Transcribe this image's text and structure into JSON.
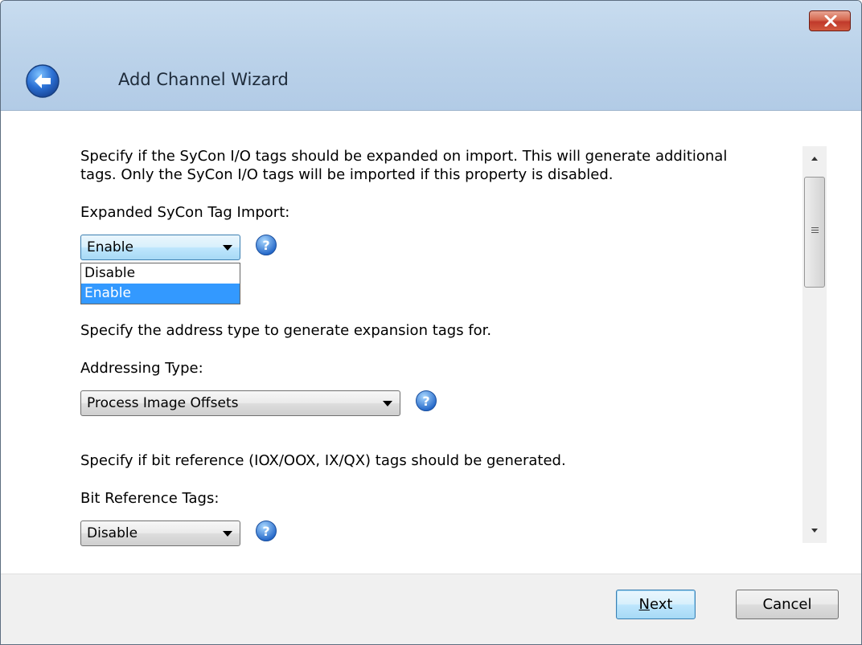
{
  "window": {
    "title": "Add Channel Wizard"
  },
  "section1": {
    "description_line1": "Specify if the SyCon I/O tags should be expanded on import. This will generate additional",
    "description_line2": "tags. Only the SyCon I/O tags will be imported if this property is disabled.",
    "label": "Expanded SyCon Tag Import:",
    "value": "Enable",
    "options": [
      "Disable",
      "Enable"
    ],
    "selected_option": "Enable"
  },
  "section2": {
    "description": "Specify the address type to generate expansion tags for.",
    "label": "Addressing Type:",
    "value": "Process Image Offsets"
  },
  "section3": {
    "description": "Specify if bit reference (IOX/OOX, IX/QX) tags should be generated.",
    "label": "Bit Reference Tags:",
    "value": "Disable"
  },
  "footer": {
    "next_label_mnemonic": "N",
    "next_label_rest": "ext",
    "cancel_label": "Cancel"
  },
  "colors": {
    "titlebar": "#bcd3ea",
    "selection": "#3399ff",
    "close_button": "#c0392b",
    "help_icon": "#2f7fd6"
  },
  "icons": {
    "close": "close-x-icon",
    "back": "back-arrow-icon",
    "help": "help-question-icon",
    "dropdown": "chevron-down-icon"
  }
}
